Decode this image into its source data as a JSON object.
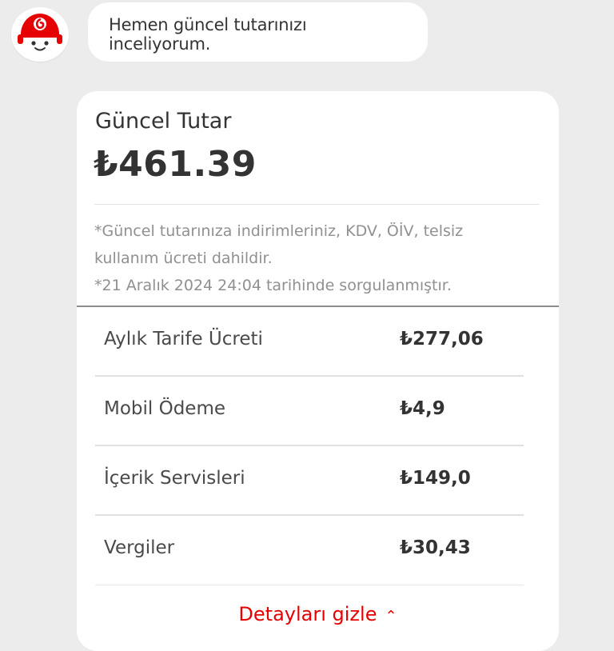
{
  "chat": {
    "bot_message": "Hemen güncel tutarınızı inceliyorum."
  },
  "summary": {
    "title": "Güncel Tutar",
    "amount": "₺461.39",
    "note_line1": "*Güncel tutarınıza indirimleriniz, KDV, ÖİV, telsiz kullanım ücreti dahildir.",
    "note_line2": "*21 Aralık 2024 24:04 tarihinde sorgulanmıştır."
  },
  "breakdown": [
    {
      "label": "Aylık Tarife Ücreti",
      "value": "₺277,06"
    },
    {
      "label": "Mobil Ödeme",
      "value": "₺4,9"
    },
    {
      "label": "İçerik Servisleri",
      "value": "₺149,0"
    },
    {
      "label": "Vergiler",
      "value": "₺30,43"
    }
  ],
  "details_toggle": {
    "label": "Detayları gizle",
    "icon": "chevron-up-icon"
  },
  "colors": {
    "brand_red": "#e60000",
    "background": "#ececec",
    "card": "#ffffff"
  }
}
